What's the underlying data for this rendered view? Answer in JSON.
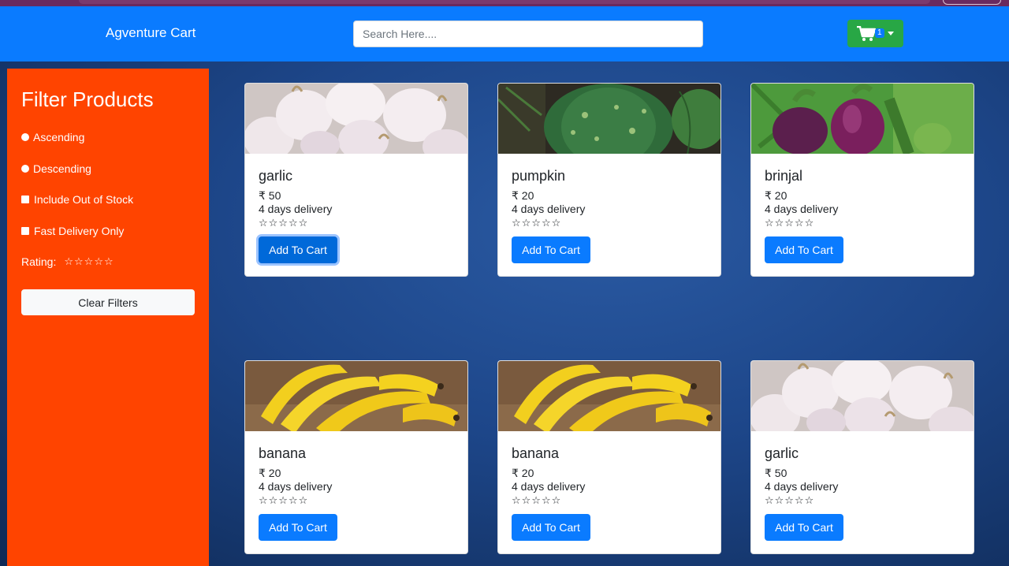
{
  "navbar": {
    "brand": "Agventure Cart",
    "search_placeholder": "Search Here....",
    "cart_count": "1"
  },
  "sidebar": {
    "title": "Filter Products",
    "ascending": "Ascending",
    "descending": "Descending",
    "include_out_of_stock": "Include Out of Stock",
    "fast_delivery": "Fast Delivery Only",
    "rating_label": "Rating:",
    "rating_stars": "☆☆☆☆☆",
    "clear_filters": "Clear Filters"
  },
  "products": [
    {
      "name": "garlic",
      "price": "₹ 50",
      "delivery": "4 days delivery",
      "stars": "☆☆☆☆☆",
      "button": "Add To Cart"
    },
    {
      "name": "pumpkin",
      "price": "₹ 20",
      "delivery": "4 days delivery",
      "stars": "☆☆☆☆☆",
      "button": "Add To Cart"
    },
    {
      "name": "brinjal",
      "price": "₹ 20",
      "delivery": "4 days delivery",
      "stars": "☆☆☆☆☆",
      "button": "Add To Cart"
    },
    {
      "name": "banana",
      "price": "₹ 20",
      "delivery": "4 days delivery",
      "stars": "☆☆☆☆☆",
      "button": "Add To Cart"
    },
    {
      "name": "banana",
      "price": "₹ 20",
      "delivery": "4 days delivery",
      "stars": "☆☆☆☆☆",
      "button": "Add To Cart"
    },
    {
      "name": "garlic",
      "price": "₹ 50",
      "delivery": "4 days delivery",
      "stars": "☆☆☆☆☆",
      "button": "Add To Cart"
    }
  ],
  "colors": {
    "navbar": "#0a7bff",
    "sidebar": "#ff4400",
    "cart_button": "#28a745",
    "primary_button": "#0a7bff"
  }
}
